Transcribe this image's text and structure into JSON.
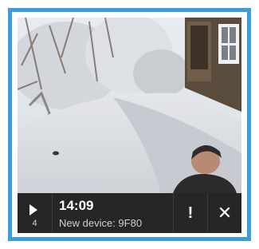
{
  "notification": {
    "event_count": "4",
    "time": "14:09",
    "message": "New device: 9F80",
    "alert_symbol": "!",
    "close_symbol": "✕"
  },
  "colors": {
    "frame_border": "#3a9fd6",
    "bar_background": "#262626"
  },
  "icons": [
    "play-icon",
    "alert-icon",
    "close-icon"
  ]
}
